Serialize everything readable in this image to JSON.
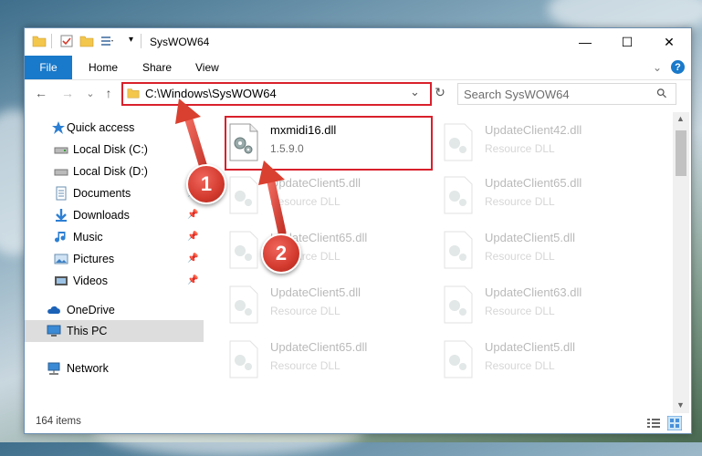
{
  "window": {
    "title": "SysWOW64",
    "minimize": "—",
    "maximize": "☐",
    "close": "✕"
  },
  "ribbon": {
    "tabs": [
      "File",
      "Home",
      "Share",
      "View"
    ],
    "expand": "⌄",
    "help": "?"
  },
  "navigation": {
    "back": "←",
    "forward": "→",
    "recent": "⌄",
    "up": "↑",
    "address": "C:\\Windows\\SysWOW64",
    "address_dropdown": "⌄",
    "refresh": "↻",
    "search_placeholder": "Search SysWOW64",
    "search_icon": "⚲"
  },
  "sidebar": {
    "items": [
      {
        "label": "Quick access",
        "icon": "star-icon",
        "pinned": false
      },
      {
        "label": "Local Disk (C:)",
        "icon": "drive-icon",
        "pinned": true
      },
      {
        "label": "Local Disk (D:)",
        "icon": "drive-icon",
        "pinned": false
      },
      {
        "label": "Documents",
        "icon": "documents-icon",
        "pinned": true
      },
      {
        "label": "Downloads",
        "icon": "download-icon",
        "pinned": true
      },
      {
        "label": "Music",
        "icon": "music-icon",
        "pinned": true
      },
      {
        "label": "Pictures",
        "icon": "pictures-icon",
        "pinned": true
      },
      {
        "label": "Videos",
        "icon": "videos-icon",
        "pinned": true
      },
      {
        "label": "OneDrive",
        "icon": "onedrive-icon",
        "pinned": false
      },
      {
        "label": "This PC",
        "icon": "computer-icon",
        "pinned": false,
        "selected": true
      },
      {
        "label": "Network",
        "icon": "network-icon",
        "pinned": false
      }
    ]
  },
  "files": [
    {
      "name": "mxmidi16.dll",
      "detail": "1.5.9.0",
      "faded": false
    },
    {
      "name": "UpdateClient42.dll",
      "detail": "Resource DLL",
      "faded": true
    },
    {
      "name": "UpdateClient5.dll",
      "detail": "Resource DLL",
      "faded": true
    },
    {
      "name": "UpdateClient65.dll",
      "detail": "Resource DLL",
      "faded": true
    },
    {
      "name": "UpdateClient65.dll",
      "detail": "Resource DLL",
      "faded": true
    },
    {
      "name": "UpdateClient5.dll",
      "detail": "Resource DLL",
      "faded": true
    },
    {
      "name": "UpdateClient5.dll",
      "detail": "Resource DLL",
      "faded": true
    },
    {
      "name": "UpdateClient63.dll",
      "detail": "Resource DLL",
      "faded": true
    },
    {
      "name": "UpdateClient65.dll",
      "detail": "Resource DLL",
      "faded": true
    },
    {
      "name": "UpdateClient5.dll",
      "detail": "Resource DLL",
      "faded": true
    }
  ],
  "status": {
    "item_count": "164 items"
  },
  "callouts": [
    "1",
    "2"
  ],
  "colors": {
    "accent": "#1979ca",
    "highlight": "#d9202c"
  }
}
